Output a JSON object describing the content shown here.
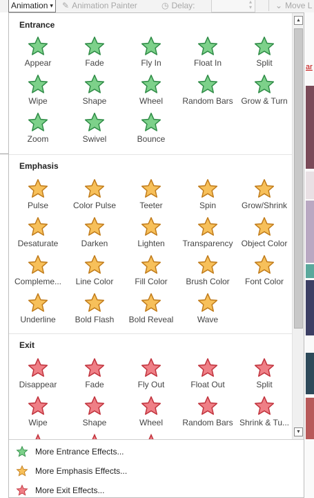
{
  "ribbon": {
    "animation_button": "Animation",
    "animation_painter": "Animation Painter",
    "delay_label": "Delay:",
    "move_label": "Move L"
  },
  "colors": {
    "entrance_fill": "#7dd18a",
    "entrance_stroke": "#2e8b46",
    "emphasis_fill": "#f7c05a",
    "emphasis_stroke": "#c07b1a",
    "exit_fill": "#ef7f86",
    "exit_stroke": "#c0323c",
    "background_red_text": "#c00000"
  },
  "background_text": {
    "right_peek": "ar"
  },
  "entrance": {
    "title": "Entrance",
    "effects": [
      {
        "label": "Appear",
        "icon": "appear-icon"
      },
      {
        "label": "Fade",
        "icon": "fade-icon"
      },
      {
        "label": "Fly In",
        "icon": "fly-in-icon"
      },
      {
        "label": "Float In",
        "icon": "float-in-icon"
      },
      {
        "label": "Split",
        "icon": "split-icon"
      },
      {
        "label": "Wipe",
        "icon": "wipe-icon"
      },
      {
        "label": "Shape",
        "icon": "shape-icon"
      },
      {
        "label": "Wheel",
        "icon": "wheel-icon"
      },
      {
        "label": "Random Bars",
        "icon": "random-bars-icon"
      },
      {
        "label": "Grow & Turn",
        "icon": "grow-turn-icon"
      },
      {
        "label": "Zoom",
        "icon": "zoom-icon"
      },
      {
        "label": "Swivel",
        "icon": "swivel-icon"
      },
      {
        "label": "Bounce",
        "icon": "bounce-icon"
      }
    ]
  },
  "emphasis": {
    "title": "Emphasis",
    "effects": [
      {
        "label": "Pulse",
        "icon": "pulse-icon"
      },
      {
        "label": "Color Pulse",
        "icon": "color-pulse-icon"
      },
      {
        "label": "Teeter",
        "icon": "teeter-icon"
      },
      {
        "label": "Spin",
        "icon": "spin-icon"
      },
      {
        "label": "Grow/Shrink",
        "icon": "grow-shrink-icon"
      },
      {
        "label": "Desaturate",
        "icon": "desaturate-icon"
      },
      {
        "label": "Darken",
        "icon": "darken-icon"
      },
      {
        "label": "Lighten",
        "icon": "lighten-icon"
      },
      {
        "label": "Transparency",
        "icon": "transparency-icon"
      },
      {
        "label": "Object Color",
        "icon": "object-color-icon"
      },
      {
        "label": "Compleme...",
        "icon": "complementary-color-icon"
      },
      {
        "label": "Line Color",
        "icon": "line-color-icon"
      },
      {
        "label": "Fill Color",
        "icon": "fill-color-icon"
      },
      {
        "label": "Brush Color",
        "icon": "brush-color-icon"
      },
      {
        "label": "Font Color",
        "icon": "font-color-icon"
      },
      {
        "label": "Underline",
        "icon": "underline-icon"
      },
      {
        "label": "Bold Flash",
        "icon": "bold-flash-icon"
      },
      {
        "label": "Bold Reveal",
        "icon": "bold-reveal-icon"
      },
      {
        "label": "Wave",
        "icon": "wave-icon"
      }
    ]
  },
  "exit": {
    "title": "Exit",
    "effects": [
      {
        "label": "Disappear",
        "icon": "disappear-icon"
      },
      {
        "label": "Fade",
        "icon": "fade-out-icon"
      },
      {
        "label": "Fly Out",
        "icon": "fly-out-icon"
      },
      {
        "label": "Float Out",
        "icon": "float-out-icon"
      },
      {
        "label": "Split",
        "icon": "split-out-icon"
      },
      {
        "label": "Wipe",
        "icon": "wipe-out-icon"
      },
      {
        "label": "Shape",
        "icon": "shape-out-icon"
      },
      {
        "label": "Wheel",
        "icon": "wheel-out-icon"
      },
      {
        "label": "Random Bars",
        "icon": "random-bars-out-icon"
      },
      {
        "label": "Shrink & Tu...",
        "icon": "shrink-turn-icon"
      }
    ]
  },
  "more_effects": [
    {
      "label": "More Entrance Effects...",
      "icon": "entrance-star-icon"
    },
    {
      "label": "More Emphasis Effects...",
      "icon": "emphasis-star-icon"
    },
    {
      "label": "More Exit Effects...",
      "icon": "exit-star-icon"
    }
  ]
}
